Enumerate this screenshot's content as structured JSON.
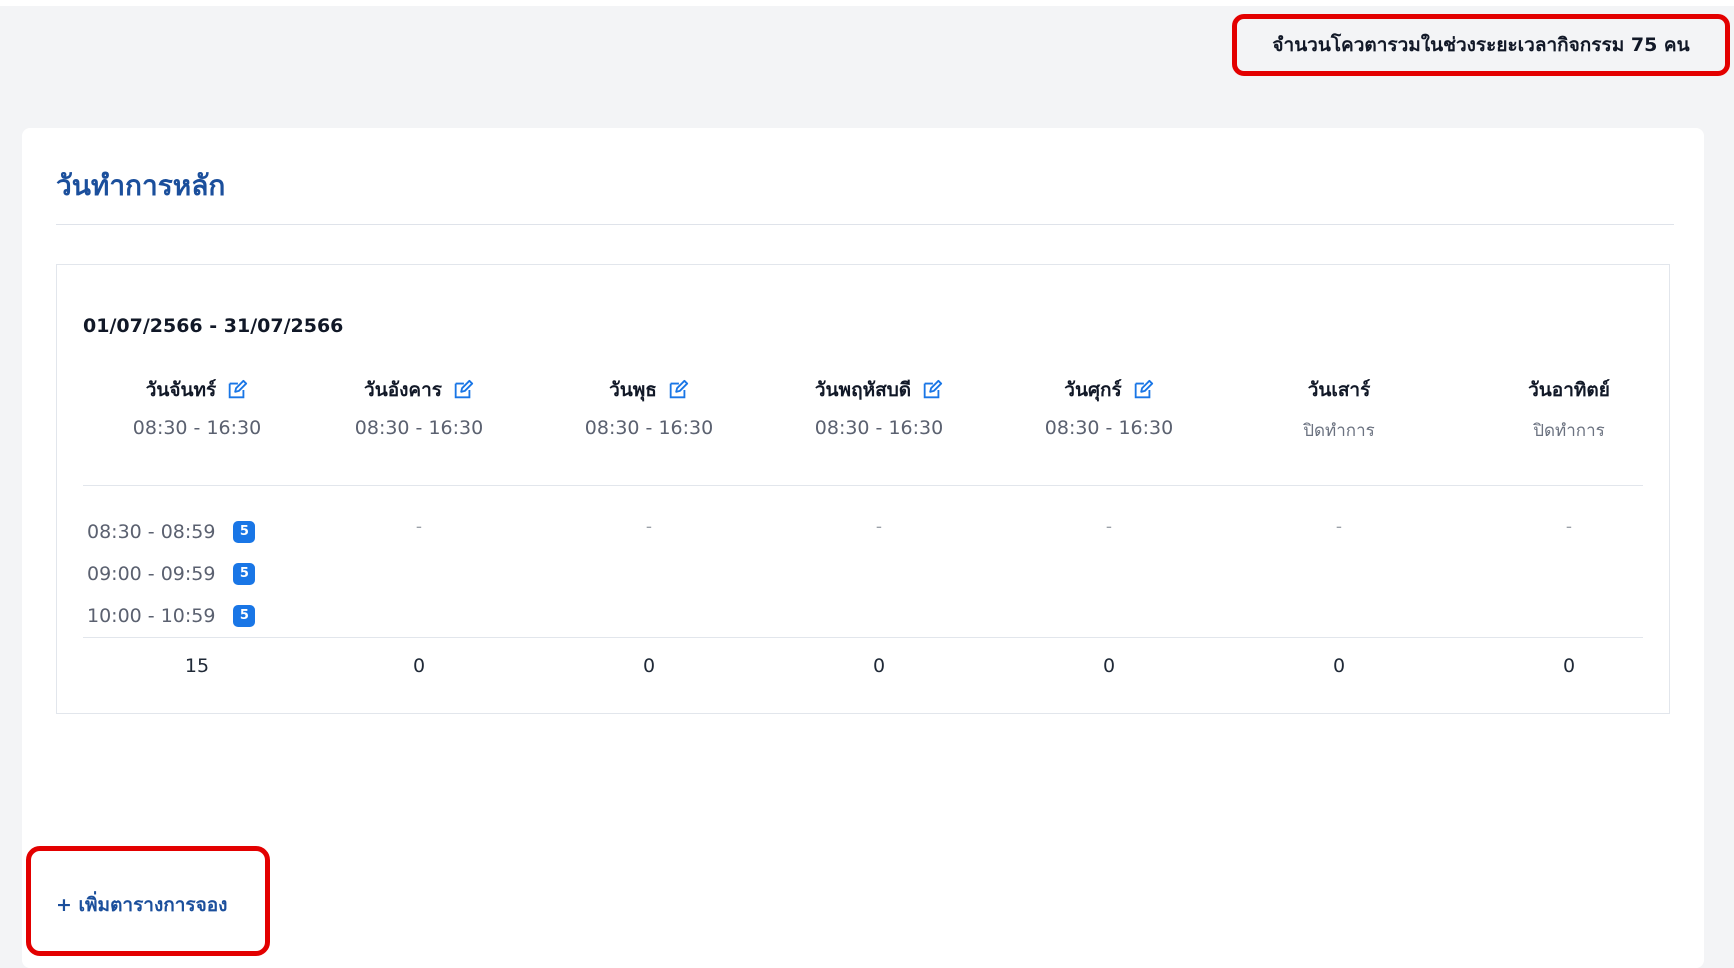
{
  "quota_banner": {
    "text": "จำนวนโควตารวมในช่วงระยะเวลากิจกรรม 75 คน"
  },
  "card": {
    "title": "วันทำการหลัก"
  },
  "schedule": {
    "date_range": "01/07/2566 - 31/07/2566",
    "days": [
      {
        "name": "วันจันทร์",
        "hours": "08:30 - 16:30",
        "editable": true,
        "total": "15"
      },
      {
        "name": "วันอังคาร",
        "hours": "08:30 - 16:30",
        "editable": true,
        "total": "0",
        "slot_placeholder": "-"
      },
      {
        "name": "วันพุธ",
        "hours": "08:30 - 16:30",
        "editable": true,
        "total": "0",
        "slot_placeholder": "-"
      },
      {
        "name": "วันพฤหัสบดี",
        "hours": "08:30 - 16:30",
        "editable": true,
        "total": "0",
        "slot_placeholder": "-"
      },
      {
        "name": "วันศุกร์",
        "hours": "08:30 - 16:30",
        "editable": true,
        "total": "0",
        "slot_placeholder": "-"
      },
      {
        "name": "วันเสาร์",
        "hours": "ปิดทำการ",
        "editable": false,
        "total": "0",
        "slot_placeholder": "-"
      },
      {
        "name": "วันอาทิตย์",
        "hours": "ปิดทำการ",
        "editable": false,
        "total": "0",
        "slot_placeholder": "-"
      }
    ],
    "monday_slots": [
      {
        "time": "08:30 - 08:59",
        "quota": "5"
      },
      {
        "time": "09:00 - 09:59",
        "quota": "5"
      },
      {
        "time": "10:00 - 10:59",
        "quota": "5"
      }
    ]
  },
  "actions": {
    "add_schedule_label": "+ เพิ่มตารางการจอง"
  },
  "colors": {
    "accent_blue": "#1b4f9c",
    "badge_blue": "#1976e6",
    "highlight_red": "#e30000"
  },
  "icons": {
    "edit": "edit-icon"
  }
}
